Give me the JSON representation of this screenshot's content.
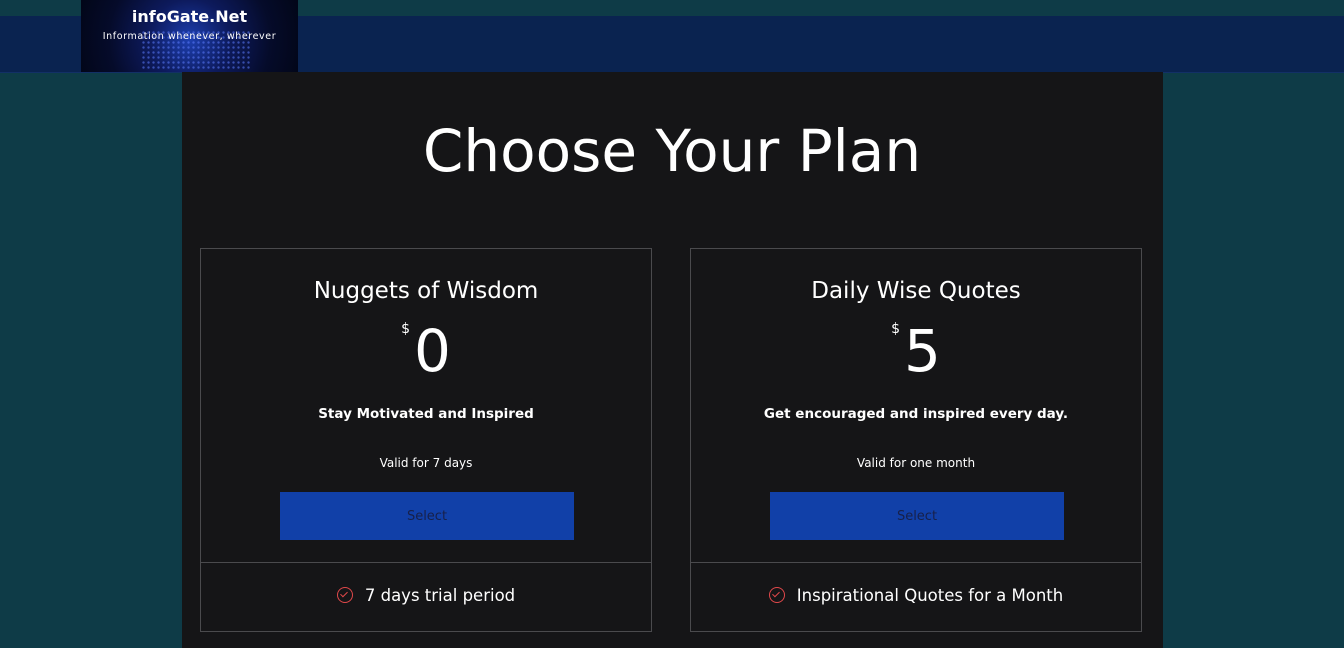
{
  "header": {
    "logo_title": "infoGate.Net",
    "logo_tagline": "Information whenever, wherever"
  },
  "page": {
    "title": "Choose Your Plan"
  },
  "plans": [
    {
      "name": "Nuggets of Wisdom",
      "currency": "$",
      "price": "0",
      "description": "Stay Motivated and Inspired",
      "validity": "Valid for 7 days",
      "button_label": "Select",
      "feature": "7 days trial period",
      "feature_icon": "check-circle-icon"
    },
    {
      "name": "Daily Wise Quotes",
      "currency": "$",
      "price": "5",
      "description": "Get encouraged and inspired every day.",
      "validity": "Valid for one month",
      "button_label": "Select",
      "feature": "Inspirational Quotes for a Month",
      "feature_icon": "check-circle-icon"
    }
  ],
  "colors": {
    "background": "#0e3b47",
    "header_bar": "#0a2350",
    "panel": "#151517",
    "button": "#1140a8",
    "check_icon": "#e0484a"
  }
}
